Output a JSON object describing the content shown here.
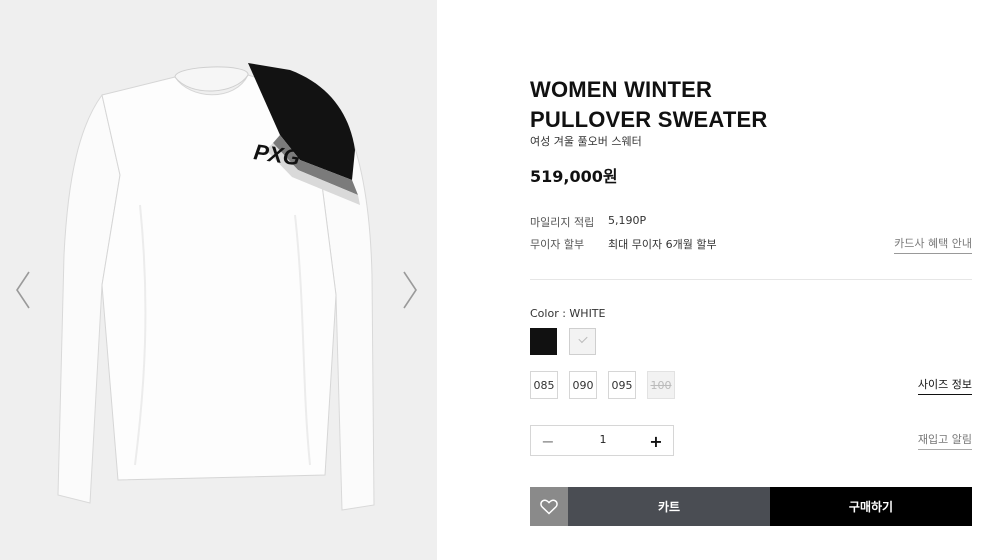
{
  "gallery": {
    "prev_icon": "chevron-left-icon",
    "next_icon": "chevron-right-icon",
    "logo_text": "PXG"
  },
  "product": {
    "title_line1": "WOMEN WINTER",
    "title_line2": "PULLOVER SWEATER",
    "subtitle": "여성 겨울 풀오버 스웨터",
    "price": "519,000원"
  },
  "meta": {
    "mileage_label": "마일리지 적립",
    "mileage_value": "5,190P",
    "installment_label": "무이자 할부",
    "installment_value": "최대 무이자 6개월 할부",
    "card_link": "카드사 혜택 안내"
  },
  "color": {
    "label": "Color : WHITE",
    "swatches": [
      {
        "name": "black",
        "hex": "#111111",
        "selected": false
      },
      {
        "name": "white",
        "hex": "#f3f3f3",
        "selected": true
      }
    ]
  },
  "sizes": {
    "options": [
      {
        "label": "085",
        "available": true
      },
      {
        "label": "090",
        "available": true
      },
      {
        "label": "095",
        "available": true
      },
      {
        "label": "100",
        "available": false
      }
    ],
    "guide_link": "사이즈 정보"
  },
  "quantity": {
    "minus": "−",
    "value": "1",
    "plus": "+",
    "restock_link": "재입고 알림"
  },
  "actions": {
    "wish_icon": "heart-icon",
    "cart_label": "카트",
    "buy_label": "구매하기"
  },
  "colors": {
    "panel_bg": "#efefef",
    "cart_bg": "#4a4d53",
    "buy_bg": "#000000",
    "wish_bg": "#8a8a8a"
  }
}
